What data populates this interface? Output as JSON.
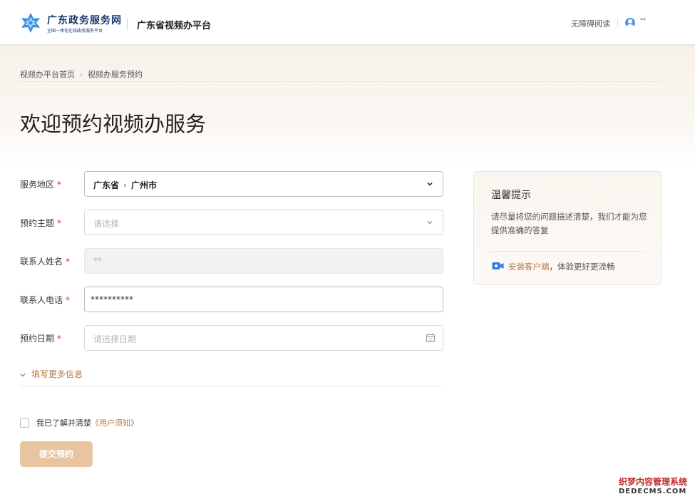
{
  "header": {
    "brand_name": "广东政务服务网",
    "brand_sub": "全国一体化在线政务服务平台",
    "platform_title": "广东省视频办平台",
    "accessibility_label": "无障碍阅读",
    "user_name": "**"
  },
  "breadcrumb": {
    "home": "视频办平台首页",
    "current": "视频办服务预约"
  },
  "page": {
    "title": "欢迎预约视频办服务"
  },
  "form": {
    "region": {
      "label": "服务地区",
      "required_mark": "*",
      "province": "广东省",
      "separator": "›",
      "city": "广州市"
    },
    "topic": {
      "label": "预约主题",
      "required_mark": "*",
      "placeholder": "请选择"
    },
    "contact_name": {
      "label": "联系人姓名",
      "required_mark": "*",
      "value": "**"
    },
    "contact_phone": {
      "label": "联系人电话",
      "required_mark": "*",
      "value": "**********"
    },
    "date": {
      "label": "预约日期",
      "required_mark": "*",
      "placeholder": "请选择日期"
    },
    "more_info_label": "填写更多信息",
    "agree_text": "我已了解并清楚",
    "agree_link": "《用户须知》",
    "submit_label": "提交预约"
  },
  "tips": {
    "title": "温馨提示",
    "body": "请尽量将您的问题描述清楚，我们才能为您提供准确的答复",
    "install_link": "安装客户端",
    "install_suffix": "，体验更好更流畅"
  },
  "watermark": {
    "line1": "织梦内容管理系统",
    "line2": "DEDECMS.COM"
  },
  "colors": {
    "accent": "#b8773c",
    "submit_disabled": "#e8c4a0",
    "required": "#d9363e",
    "brand_blue": "#1c3a6e",
    "logo_blue": "#3a8ee6"
  },
  "icons": {
    "logo": "guangdong-gov-logo",
    "user": "user-avatar-icon",
    "chevron": "chevron-down-icon",
    "calendar": "calendar-icon",
    "video": "video-camera-icon",
    "more_arrow": "chevron-down-icon"
  }
}
